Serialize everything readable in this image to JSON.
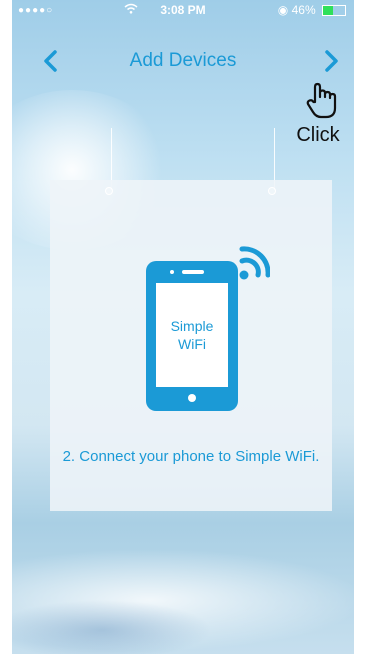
{
  "status_bar": {
    "signal": "●●●●○",
    "time": "3:08 PM",
    "battery_text": "46%",
    "battery_level": 0.46,
    "icons": [
      "signal-dots-icon",
      "wifi-icon",
      "alarm-icon",
      "battery-icon"
    ]
  },
  "nav": {
    "title": "Add Devices",
    "back_icon": "chevron-left-icon",
    "next_icon": "chevron-right-icon"
  },
  "hint": {
    "label": "Click",
    "icon": "hand-pointer-icon"
  },
  "card": {
    "screen_text": "Simple WiFi",
    "caption": "2. Connect your phone to Simple WiFi.",
    "icons": [
      "smartphone-icon",
      "wifi-signal-icon"
    ]
  },
  "colors": {
    "accent": "#1b9ad6",
    "battery": "#2fe05a"
  }
}
